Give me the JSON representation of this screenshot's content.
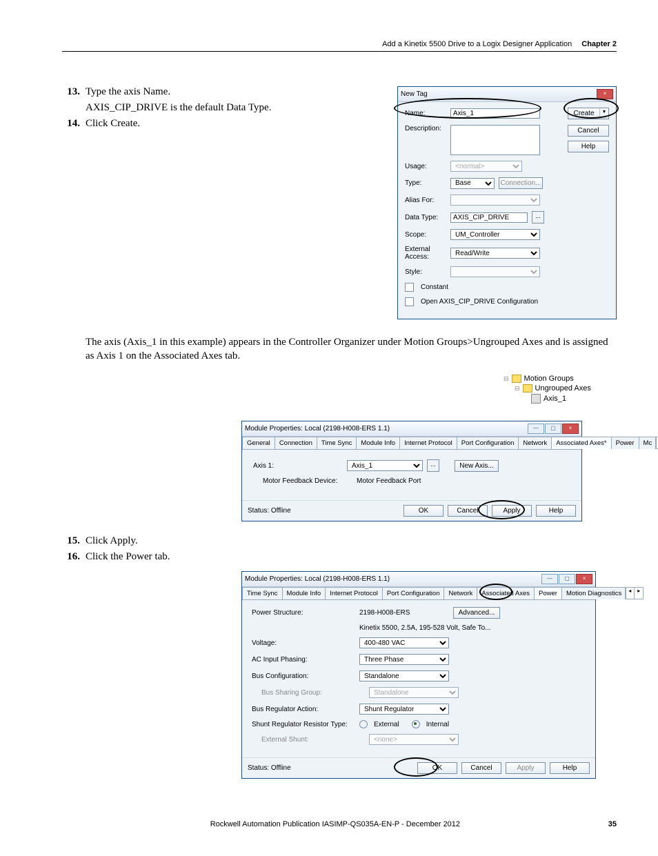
{
  "header": {
    "section_title": "Add a Kinetix 5500 Drive to a Logix Designer Application",
    "chapter": "Chapter 2"
  },
  "steps": {
    "s13_num": "13.",
    "s13_text": "Type the axis Name.",
    "s13_sub": "AXIS_CIP_DRIVE is the default Data Type.",
    "s14_num": "14.",
    "s14_text": "Click Create.",
    "s15_num": "15.",
    "s15_text": "Click Apply.",
    "s16_num": "16.",
    "s16_text": "Click the Power tab."
  },
  "newtag": {
    "title": "New Tag",
    "labels": {
      "name": "Name:",
      "desc": "Description:",
      "usage": "Usage:",
      "type": "Type:",
      "alias": "Alias For:",
      "datatype": "Data Type:",
      "scope": "Scope:",
      "ext": "External Access:",
      "style": "Style:",
      "constant": "Constant",
      "open": "Open AXIS_CIP_DRIVE Configuration"
    },
    "values": {
      "name": "Axis_1",
      "usage": "<normal>",
      "type": "Base",
      "connection": "Connection...",
      "datatype": "AXIS_CIP_DRIVE",
      "scope": "UM_Controller",
      "ext": "Read/Write"
    },
    "btns": {
      "create": "Create",
      "cancel": "Cancel",
      "help": "Help"
    }
  },
  "para1": "The axis (Axis_1 in this example) appears in the Controller Organizer under Motion Groups>Ungrouped Axes and is assigned as Axis 1 on the Associated Axes tab.",
  "tree": {
    "motion": "Motion Groups",
    "ungrouped": "Ungrouped Axes",
    "axis": "Axis_1"
  },
  "mod1": {
    "title": "Module Properties: Local (2198-H008-ERS 1.1)",
    "tabs": [
      "General",
      "Connection",
      "Time Sync",
      "Module Info",
      "Internet Protocol",
      "Port Configuration",
      "Network",
      "Associated Axes*",
      "Power",
      "Mc"
    ],
    "active_tab": 7,
    "axis1_label": "Axis 1:",
    "axis1_value": "Axis_1",
    "newaxis": "New Axis...",
    "mfd": "Motor Feedback Device:",
    "mfp": "Motor Feedback Port",
    "status": "Status: Offline",
    "btns": {
      "ok": "OK",
      "cancel": "Cancel",
      "apply": "Apply",
      "help": "Help"
    }
  },
  "mod2": {
    "title": "Module Properties: Local (2198-H008-ERS 1.1)",
    "tabs": [
      "Time Sync",
      "Module Info",
      "Internet Protocol",
      "Port Configuration",
      "Network",
      "Associated Axes",
      "Power",
      "Motion Diagnostics"
    ],
    "active_tab": 6,
    "labels": {
      "ps": "Power Structure:",
      "volt": "Voltage:",
      "ac": "AC Input Phasing:",
      "bus": "Bus Configuration:",
      "bsg": "Bus Sharing Group:",
      "bra": "Bus Regulator Action:",
      "srrt": "Shunt Regulator Resistor Type:",
      "es": "External Shunt:"
    },
    "values": {
      "ps": "2198-H008-ERS",
      "ps_sub": "Kinetix 5500, 2.5A, 195-528 Volt, Safe To...",
      "volt": "400-480 VAC",
      "ac": "Three Phase",
      "bus": "Standalone",
      "bsg": "Standalone",
      "bra": "Shunt Regulator",
      "ext": "External",
      "int": "Internal",
      "es": "<none>"
    },
    "adv": "Advanced...",
    "status": "Status: Offline",
    "btns": {
      "ok": "OK",
      "cancel": "Cancel",
      "apply": "Apply",
      "help": "Help"
    }
  },
  "footer": {
    "pub": "Rockwell Automation Publication IASIMP-QS035A-EN-P - December 2012",
    "page": "35"
  }
}
